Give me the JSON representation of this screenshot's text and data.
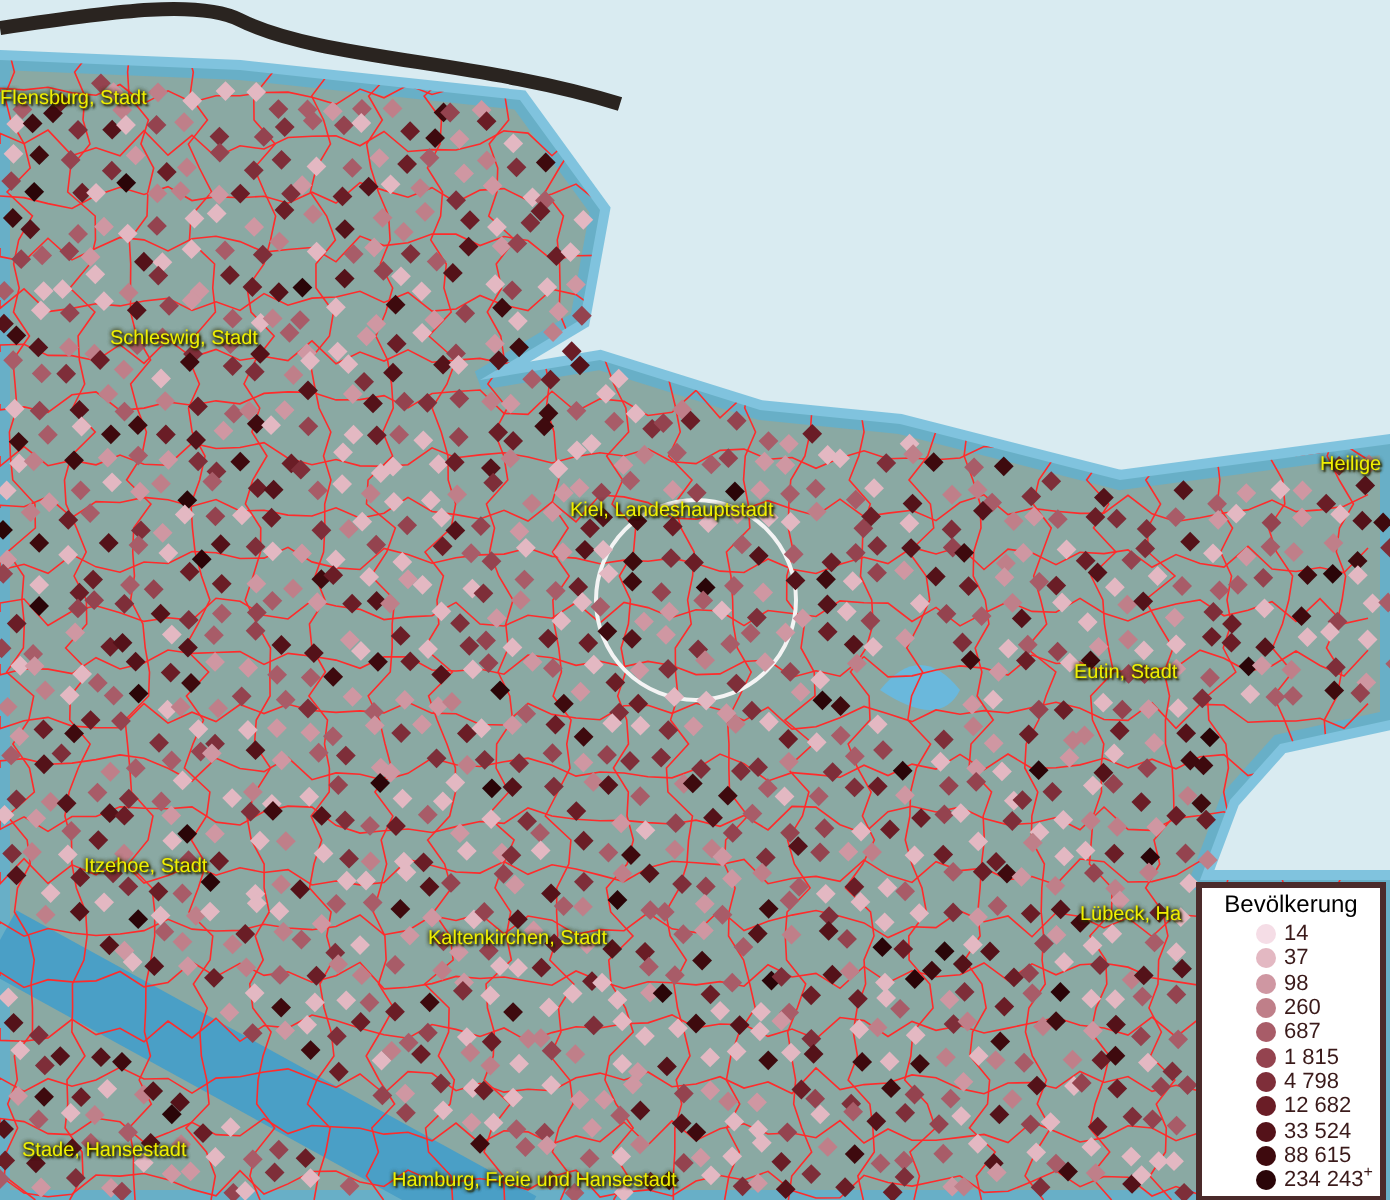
{
  "map": {
    "labels": [
      {
        "text": "Flensburg, Stadt"
      },
      {
        "text": "Schleswig, Stadt"
      },
      {
        "text": "Kiel, Landeshauptstadt"
      },
      {
        "text": "Heilige"
      },
      {
        "text": "Eutin, Stadt"
      },
      {
        "text": "Itzehoe, Stadt"
      },
      {
        "text": "Kaltenkirchen, Stadt"
      },
      {
        "text": "Lübeck, Ha"
      },
      {
        "text": "Stade, Hansestadt"
      },
      {
        "text": "Hamburg, Freie und Hansestadt"
      }
    ]
  },
  "legend": {
    "title": "Bevölkerung",
    "items": [
      {
        "label": "14",
        "color": "#f5dde6"
      },
      {
        "label": "37",
        "color": "#e3b8c2"
      },
      {
        "label": "98",
        "color": "#cf97a2"
      },
      {
        "label": "260",
        "color": "#bf7f89"
      },
      {
        "label": "687",
        "color": "#a85c68"
      },
      {
        "label": "1 815",
        "color": "#94434f"
      },
      {
        "label": "4 798",
        "color": "#7e2e39"
      },
      {
        "label": "12 682",
        "color": "#6a1d26"
      },
      {
        "label": "33 524",
        "color": "#541219"
      },
      {
        "label": "88 615",
        "color": "#3e0a0e"
      },
      {
        "label": "234 243$^{+}$",
        "color": "#2a0508"
      }
    ]
  }
}
